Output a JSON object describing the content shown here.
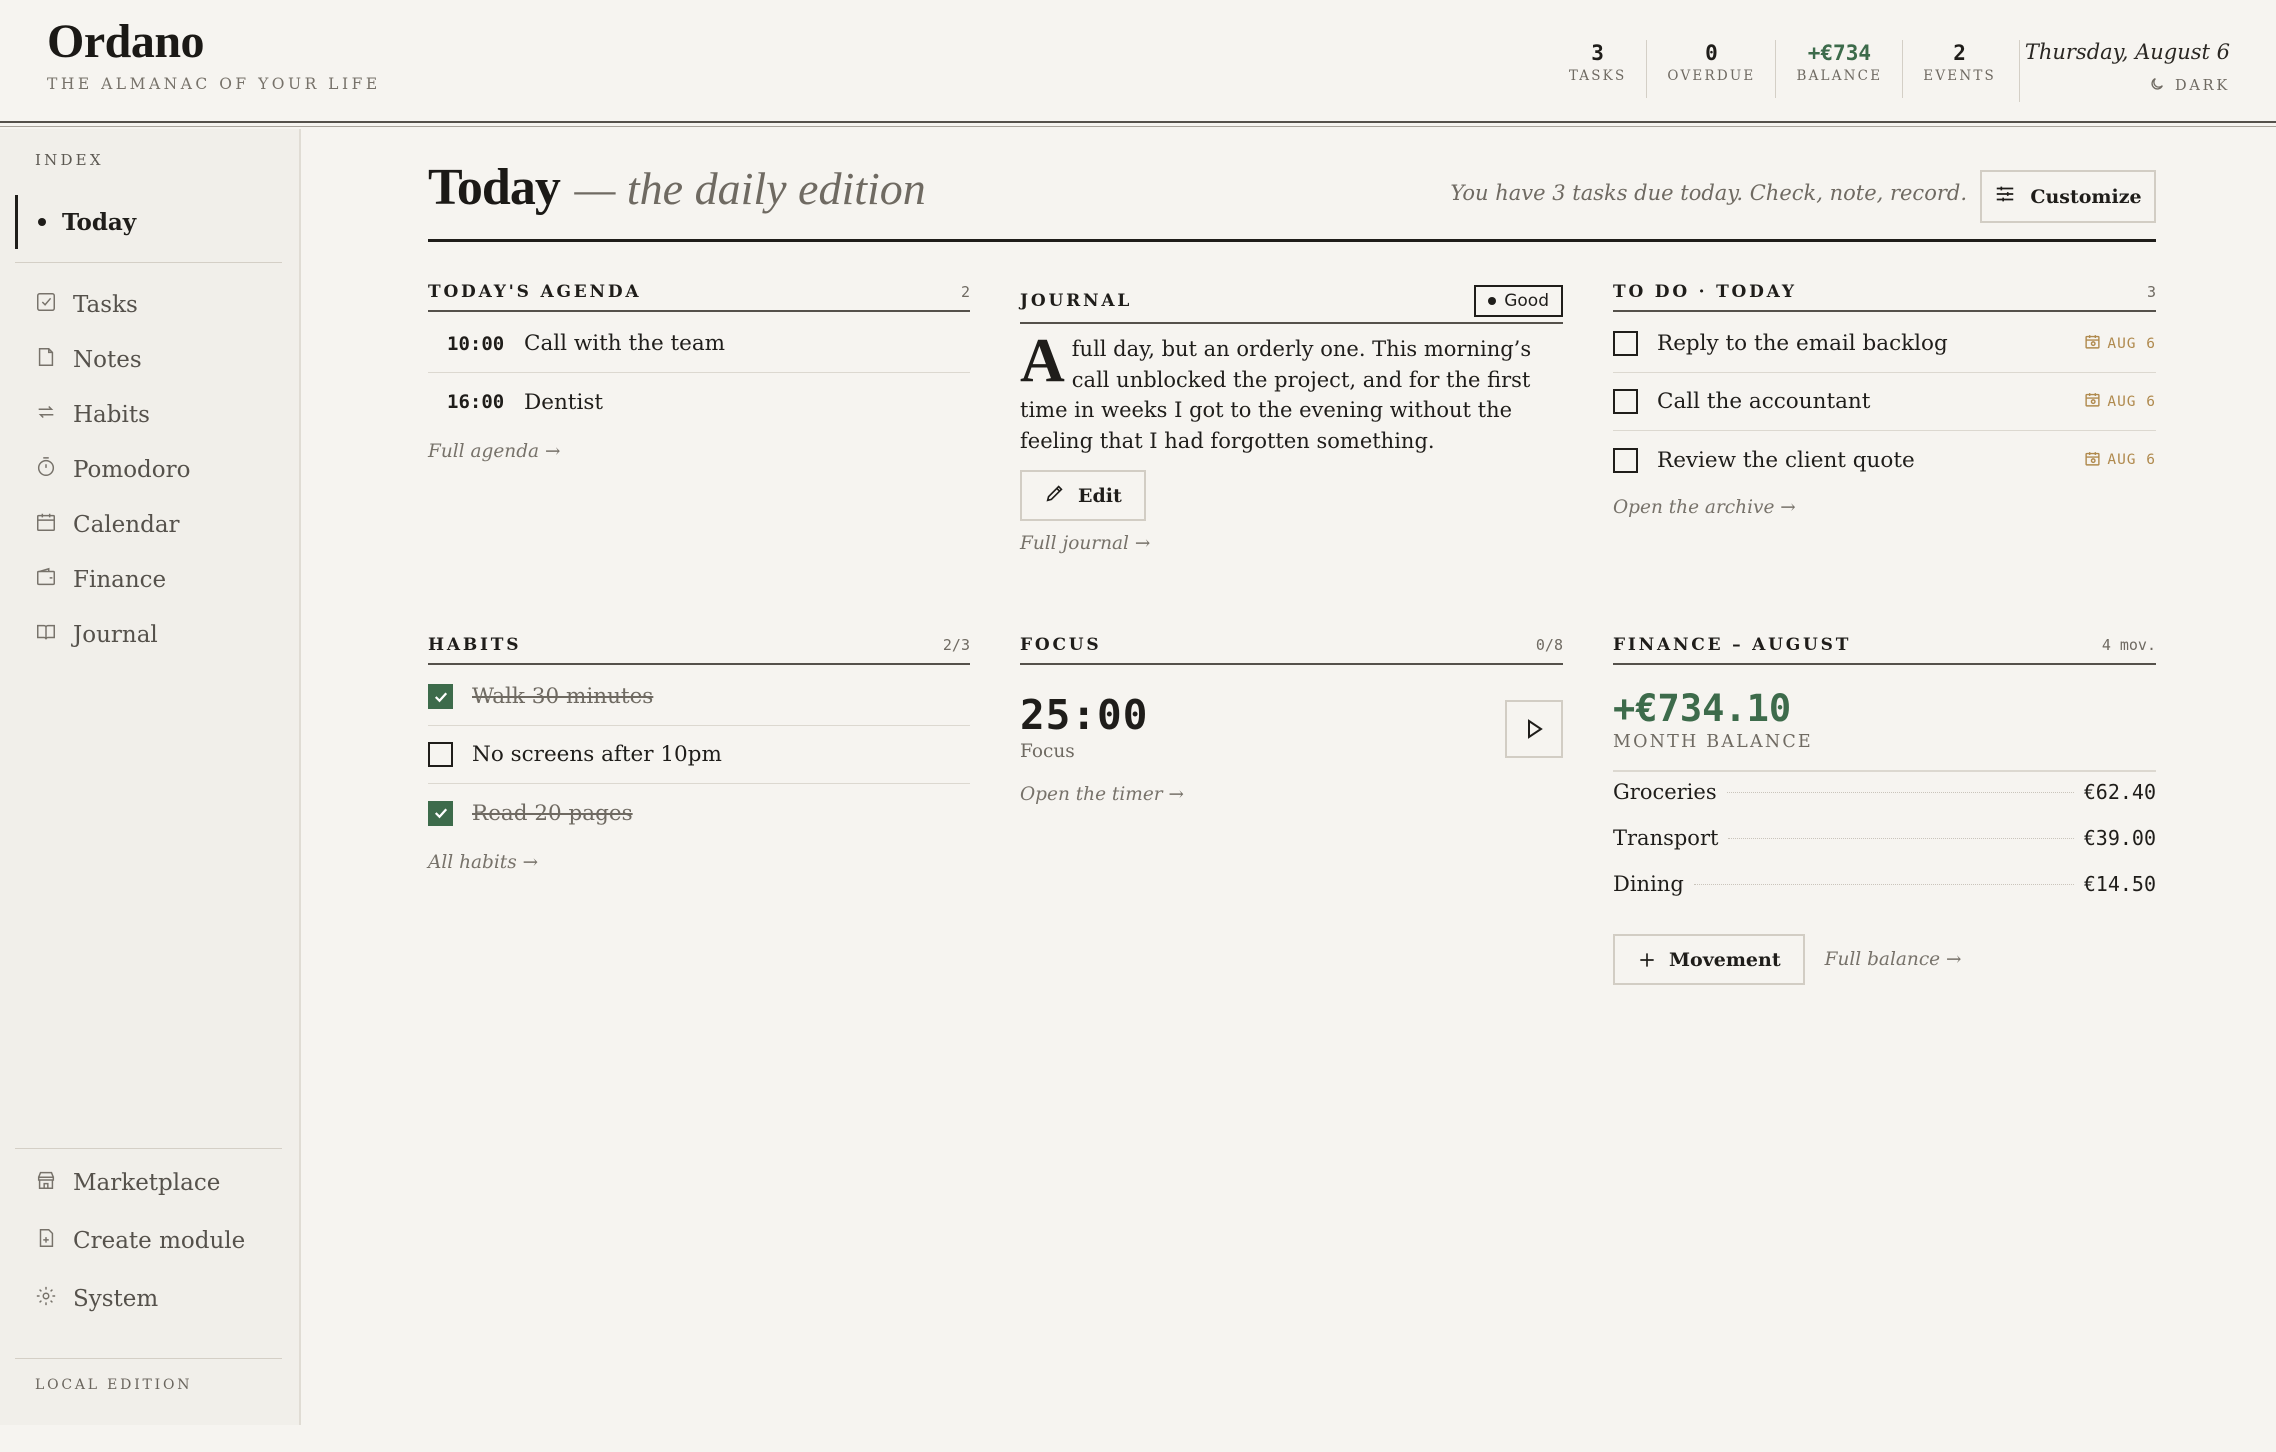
{
  "app": {
    "name": "Ordano",
    "tagline": "THE ALMANAC OF YOUR LIFE"
  },
  "header": {
    "stats": [
      {
        "value": "3",
        "label": "TASKS",
        "accent": false
      },
      {
        "value": "0",
        "label": "OVERDUE",
        "accent": false
      },
      {
        "value": "+€734",
        "label": "BALANCE",
        "accent": true
      },
      {
        "value": "2",
        "label": "EVENTS",
        "accent": false
      }
    ],
    "date": "Thursday, August 6",
    "theme_toggle_label": "DARK"
  },
  "sidebar": {
    "section_label": "INDEX",
    "active_item": "Today",
    "items": [
      {
        "label": "Tasks",
        "icon": "check-square-icon"
      },
      {
        "label": "Notes",
        "icon": "note-icon"
      },
      {
        "label": "Habits",
        "icon": "repeat-icon"
      },
      {
        "label": "Pomodoro",
        "icon": "timer-icon"
      },
      {
        "label": "Calendar",
        "icon": "calendar-icon"
      },
      {
        "label": "Finance",
        "icon": "wallet-icon"
      },
      {
        "label": "Journal",
        "icon": "book-icon"
      }
    ],
    "bottom_items": [
      {
        "label": "Marketplace",
        "icon": "store-icon"
      },
      {
        "label": "Create module",
        "icon": "file-plus-icon"
      },
      {
        "label": "System",
        "icon": "gear-icon"
      }
    ],
    "footer": "LOCAL EDITION"
  },
  "main": {
    "title": "Today",
    "title_suffix": "— the daily edition",
    "subtitle": "You have 3 tasks due today. Check, note, record.",
    "customize_label": "Customize",
    "agenda": {
      "title": "TODAY'S AGENDA",
      "count": "2",
      "items": [
        {
          "time": "10:00",
          "text": "Call with the team"
        },
        {
          "time": "16:00",
          "text": "Dentist"
        }
      ],
      "link": "Full agenda →"
    },
    "journal": {
      "title": "JOURNAL",
      "mood": "Good",
      "dropcap": "A",
      "text": "full day, but an orderly one. This morning’s call unblocked the project, and for the first time in weeks I got to the evening without the feeling that I had forgotten something.",
      "edit_label": "Edit",
      "link": "Full journal →"
    },
    "todo": {
      "title": "TO DO · TODAY",
      "count": "3",
      "items": [
        {
          "text": "Reply to the email backlog",
          "due": "AUG 6"
        },
        {
          "text": "Call the accountant",
          "due": "AUG 6"
        },
        {
          "text": "Review the client quote",
          "due": "AUG 6"
        }
      ],
      "link": "Open the archive →"
    },
    "habits": {
      "title": "HABITS",
      "count": "2/3",
      "items": [
        {
          "text": "Walk 30 minutes",
          "done": true
        },
        {
          "text": "No screens after 10pm",
          "done": false
        },
        {
          "text": "Read 20 pages",
          "done": true
        }
      ],
      "link": "All habits →"
    },
    "focus": {
      "title": "FOCUS",
      "count": "0/8",
      "timer": "25:00",
      "mode": "Focus",
      "link": "Open the timer →"
    },
    "finance": {
      "title": "FINANCE – AUGUST",
      "count": "4 mov.",
      "balance": "+€734.10",
      "balance_label": "MONTH BALANCE",
      "rows": [
        {
          "label": "Groceries",
          "amount": "€62.40"
        },
        {
          "label": "Transport",
          "amount": "€39.00"
        },
        {
          "label": "Dining",
          "amount": "€14.50"
        }
      ],
      "movement_label": "Movement",
      "link": "Full balance →"
    }
  },
  "colors": {
    "accent_green": "#3d6b4b",
    "due_amber": "#b08a4e",
    "ink": "#1f1d1a",
    "paper": "#f6f4f0"
  }
}
